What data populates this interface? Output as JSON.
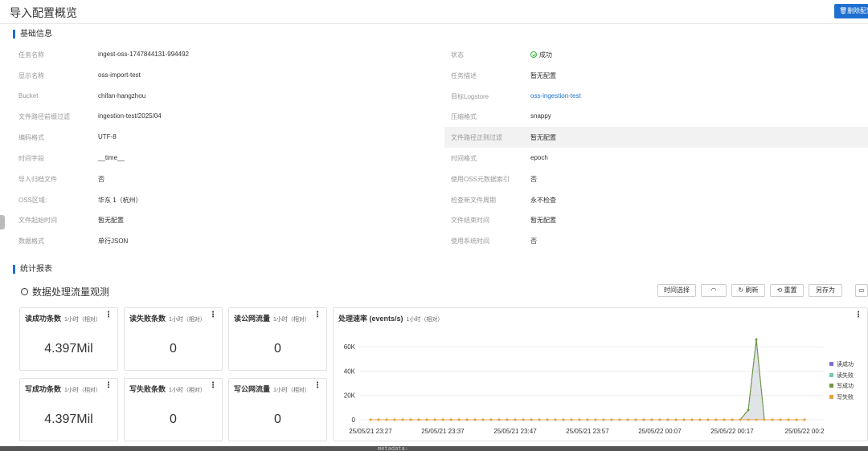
{
  "header": {
    "title": "导入配置概览",
    "delete_label": "删除配置"
  },
  "basic_info": {
    "section_title": "基础信息",
    "left": [
      {
        "label": "任务名称",
        "value": "ingest-oss-1747844131-994492"
      },
      {
        "label": "显示名称",
        "value": "oss-import-test"
      },
      {
        "label": "Bucket",
        "value": "chifan-hangzhou"
      },
      {
        "label": "文件路径前缀过滤",
        "value": "ingestion-test/2025/04"
      },
      {
        "label": "编码格式",
        "value": "UTF-8"
      },
      {
        "label": "时间字段",
        "value": "__time__"
      },
      {
        "label": "导入归档文件",
        "value": "否"
      },
      {
        "label": "OSS区域:",
        "value": "华东 1（杭州）"
      },
      {
        "label": "文件起始时间",
        "value": "暂无配置"
      },
      {
        "label": "数据格式",
        "value": "单行JSON"
      }
    ],
    "right": [
      {
        "label": "状态",
        "value": "成功"
      },
      {
        "label": "任务描述",
        "value": "暂无配置"
      },
      {
        "label": "目标Logstore",
        "value": "oss-ingestion-test"
      },
      {
        "label": "压缩格式",
        "value": "snappy"
      },
      {
        "label": "文件路径正则过滤",
        "value": "暂无配置"
      },
      {
        "label": "时间格式",
        "value": "epoch"
      },
      {
        "label": "使用OSS元数据索引",
        "value": "否"
      },
      {
        "label": "检查新文件周期",
        "value": "永不检查"
      },
      {
        "label": "文件结束时间",
        "value": "暂无配置"
      },
      {
        "label": "使用系统时间",
        "value": "否"
      }
    ]
  },
  "stats": {
    "section_title": "统计报表",
    "dashboard_title": "数据处理流量观测",
    "toolbar": {
      "time_select": "时间选择",
      "refresh": "刷新",
      "reset": "重置",
      "save_as": "另存为"
    },
    "cards": [
      {
        "title": "读成功条数",
        "sub": "1小时（相对）",
        "value": "4.397Mil"
      },
      {
        "title": "读失败条数",
        "sub": "1小时（相对）",
        "value": "0"
      },
      {
        "title": "读公网流量",
        "sub": "1小时（相对）",
        "value": "0"
      },
      {
        "title": "写成功条数",
        "sub": "1小时（相对）",
        "value": "4.397Mil"
      },
      {
        "title": "写失败条数",
        "sub": "1小时（相对）",
        "value": "0"
      },
      {
        "title": "写公网流量",
        "sub": "1小时（相对）",
        "value": "0"
      }
    ],
    "chart_panel": {
      "title": "处理速率 (events/s)",
      "sub": "1小时（相对）"
    }
  },
  "bottom_text": "metadata:",
  "colors": {
    "accent": "#1f6fd1",
    "success": "#3bb346"
  },
  "chart_data": {
    "type": "line",
    "title": "处理速率 (events/s)",
    "xlabel": "",
    "ylabel": "",
    "ylim": [
      0,
      70000
    ],
    "yticks": [
      "0",
      "20K",
      "40K",
      "60K"
    ],
    "xticks": [
      "25/05/21 23:27",
      "25/05/21 23:37",
      "25/05/21 23:47",
      "25/05/21 23:57",
      "25/05/22 00:07",
      "25/05/22 00:17",
      "25/05/22 00:2"
    ],
    "legend": "right",
    "points_per_series": 55,
    "series": [
      {
        "name": "读成功",
        "color": "#7b6fd6",
        "values": [
          0,
          0,
          0,
          0,
          0,
          0,
          0,
          0,
          0,
          0,
          0,
          0,
          0,
          0,
          0,
          0,
          0,
          0,
          0,
          0,
          0,
          0,
          0,
          0,
          0,
          0,
          0,
          0,
          0,
          0,
          0,
          0,
          0,
          0,
          0,
          0,
          0,
          0,
          0,
          0,
          0,
          0,
          0,
          0,
          0,
          0,
          0,
          8000,
          66000,
          0,
          0,
          0,
          0,
          0,
          0
        ]
      },
      {
        "name": "读失败",
        "color": "#6fc8b8",
        "values": [
          0,
          0,
          0,
          0,
          0,
          0,
          0,
          0,
          0,
          0,
          0,
          0,
          0,
          0,
          0,
          0,
          0,
          0,
          0,
          0,
          0,
          0,
          0,
          0,
          0,
          0,
          0,
          0,
          0,
          0,
          0,
          0,
          0,
          0,
          0,
          0,
          0,
          0,
          0,
          0,
          0,
          0,
          0,
          0,
          0,
          0,
          0,
          0,
          0,
          0,
          0,
          0,
          0,
          0,
          0
        ]
      },
      {
        "name": "写成功",
        "color": "#6a9a3a",
        "values": [
          0,
          0,
          0,
          0,
          0,
          0,
          0,
          0,
          0,
          0,
          0,
          0,
          0,
          0,
          0,
          0,
          0,
          0,
          0,
          0,
          0,
          0,
          0,
          0,
          0,
          0,
          0,
          0,
          0,
          0,
          0,
          0,
          0,
          0,
          0,
          0,
          0,
          0,
          0,
          0,
          0,
          0,
          0,
          0,
          0,
          0,
          0,
          8000,
          66000,
          0,
          0,
          0,
          0,
          0,
          0
        ]
      },
      {
        "name": "写失败",
        "color": "#e8a040",
        "values": [
          0,
          0,
          0,
          0,
          0,
          0,
          0,
          0,
          0,
          0,
          0,
          0,
          0,
          0,
          0,
          0,
          0,
          0,
          0,
          0,
          0,
          0,
          0,
          0,
          0,
          0,
          0,
          0,
          0,
          0,
          0,
          0,
          0,
          0,
          0,
          0,
          0,
          0,
          0,
          0,
          0,
          0,
          0,
          0,
          0,
          0,
          0,
          0,
          0,
          0,
          0,
          0,
          0,
          0,
          0
        ]
      }
    ]
  }
}
